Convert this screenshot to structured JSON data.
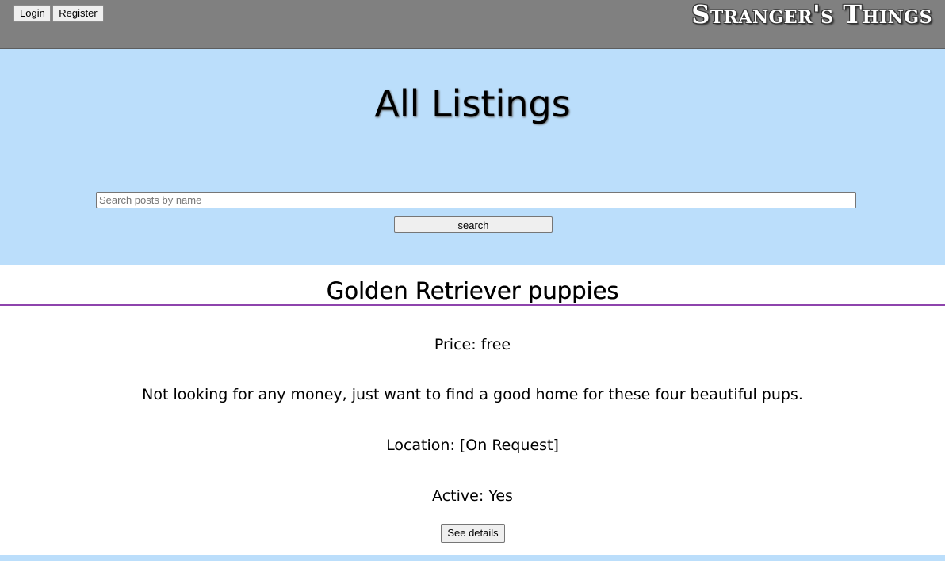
{
  "header": {
    "login_label": "Login",
    "register_label": "Register",
    "brand": "Stranger's Things"
  },
  "banner": {
    "title": "All Listings",
    "search_placeholder": "Search posts by name",
    "search_value": "",
    "search_button_label": "search"
  },
  "listings": [
    {
      "title": "Golden Retriever puppies",
      "price": "Price: free",
      "description": "Not looking for any money, just want to find a good home for these four beautiful pups.",
      "location": "Location: [On Request]",
      "active": "Active: Yes",
      "details_button_label": "See details"
    }
  ],
  "colors": {
    "header_bg": "#808080",
    "banner_bg": "#bbdefb",
    "divider": "#8e44ad"
  }
}
